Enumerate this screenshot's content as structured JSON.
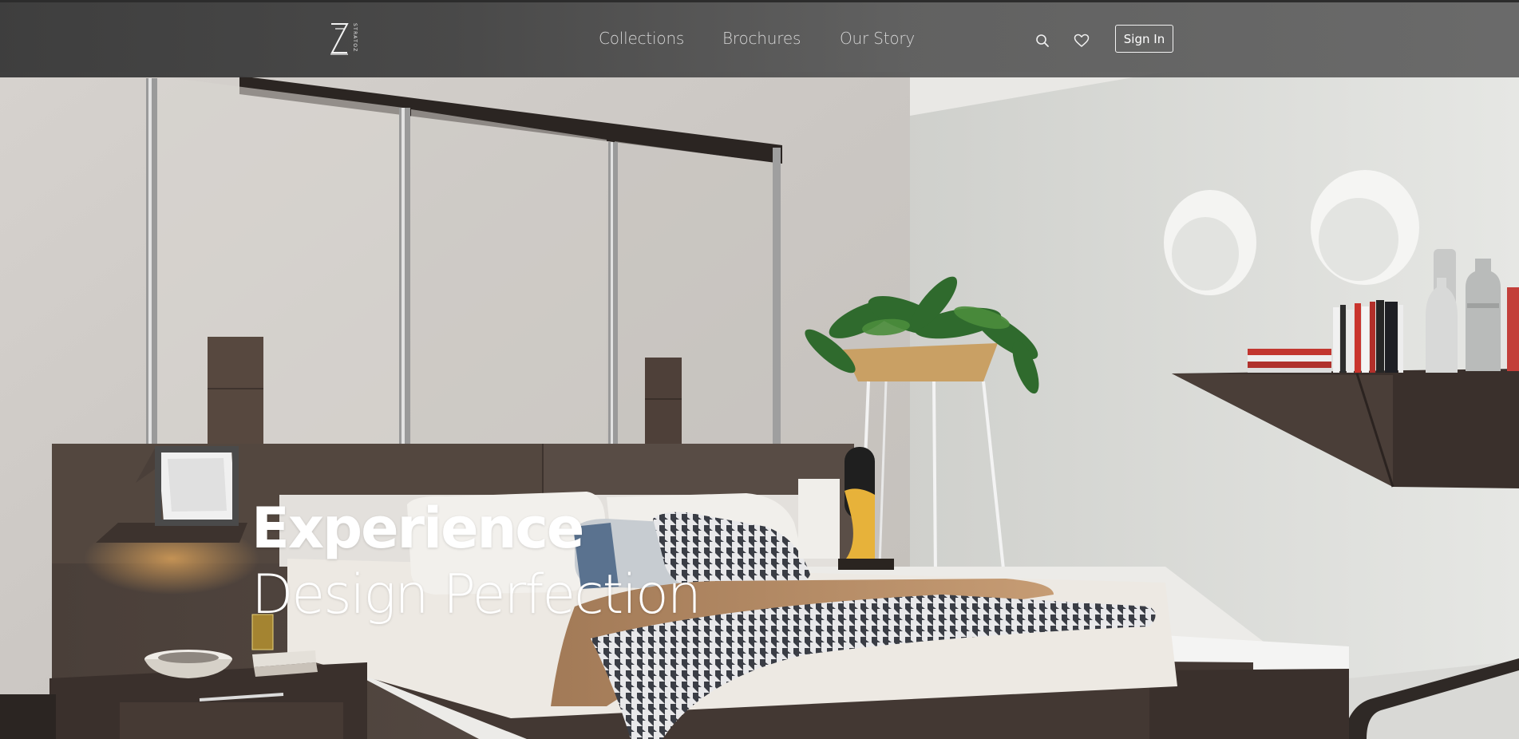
{
  "brand": {
    "logo_letter": "Z",
    "logo_word": "STRATOZ"
  },
  "nav": {
    "links": [
      {
        "label": "Collections"
      },
      {
        "label": "Brochures"
      },
      {
        "label": "Our Story"
      }
    ],
    "search_icon": "search-icon",
    "wishlist_icon": "heart-icon",
    "sign_in_label": "Sign In"
  },
  "hero": {
    "title": "Experience",
    "subtitle": "Design Perfection"
  },
  "colors": {
    "navbar_bg": "#4a4a4a",
    "nav_text": "#d6d6d6",
    "hero_text": "#ffffff",
    "wall": "#d4d1cd",
    "headboard": "#4e433d"
  }
}
